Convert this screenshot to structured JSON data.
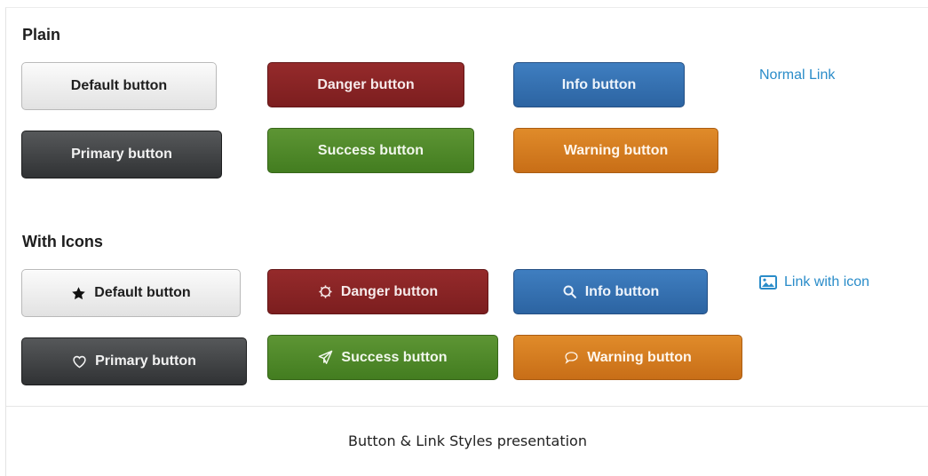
{
  "sections": {
    "plain": {
      "title": "Plain"
    },
    "icons": {
      "title": "With Icons"
    }
  },
  "plain_buttons": {
    "default": "Default button",
    "primary": "Primary button",
    "danger": "Danger button",
    "success": "Success button",
    "info": "Info button",
    "warning": "Warning button",
    "link": "Normal Link"
  },
  "icon_buttons": {
    "default": {
      "label": "Default button",
      "icon": "star-icon"
    },
    "primary": {
      "label": "Primary button",
      "icon": "heart-icon"
    },
    "danger": {
      "label": "Danger button",
      "icon": "gear-icon"
    },
    "success": {
      "label": "Success button",
      "icon": "paper-plane-icon"
    },
    "info": {
      "label": "Info button",
      "icon": "search-icon"
    },
    "warning": {
      "label": "Warning button",
      "icon": "speech-bubble-icon"
    },
    "link": {
      "label": "Link with icon",
      "icon": "image-icon"
    }
  },
  "caption": "Button & Link Styles presentation",
  "colors": {
    "link": "#2a8cc9",
    "primary": "#3a3c3e",
    "danger": "#8a2526",
    "info": "#3673b3",
    "success": "#4f8a2a",
    "warning": "#d57d20"
  }
}
